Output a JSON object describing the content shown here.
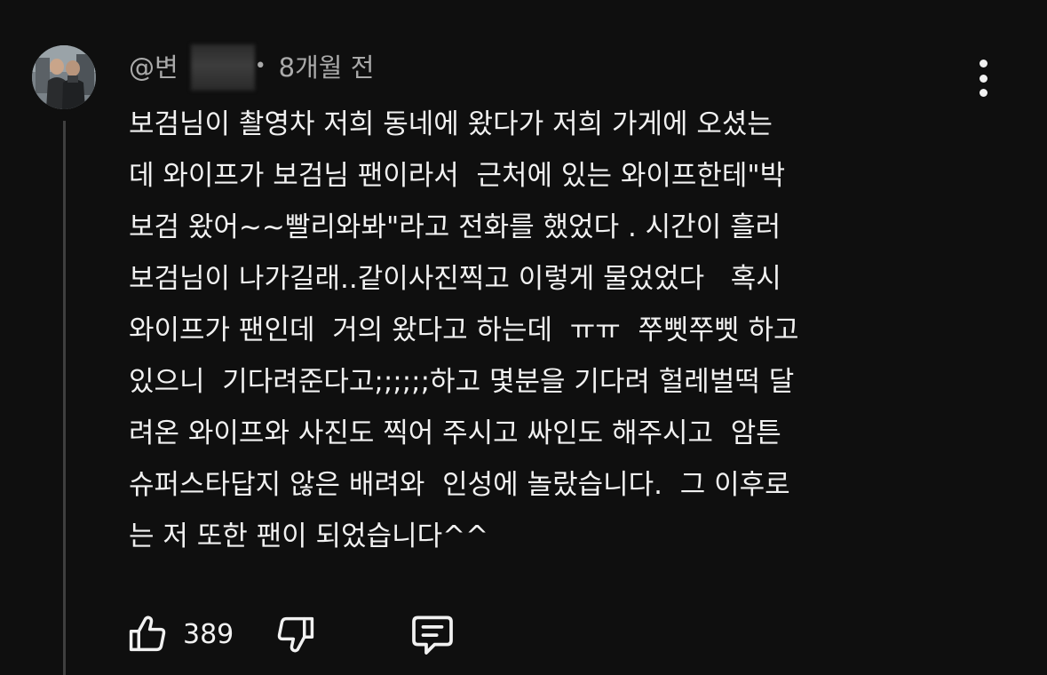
{
  "comment": {
    "author_handle": "@변",
    "timestamp": "8개월 전",
    "separator": "•",
    "lines": [
      "보검님이 촬영차 저희 동네에 왔다가 저희 가게에 오셨는",
      "데 와이프가 보검님 팬이라서  근처에 있는 와이프한테\"박",
      "보검 왔어~~빨리와봐\"라고 전화를 했었다 . 시간이 흘러",
      "보검님이 나가길래..같이사진찍고 이렇게 물었었다   혹시",
      "와이프가 팬인데  거의 왔다고 하는데  ㅠㅠ  쭈삣쭈삣 하고",
      "있으니  기다려준다고;;;;;;하고 몇분을 기다려 헐레벌떡 달",
      "려온 와이프와 사진도 찍어 주시고 싸인도 해주시고  암튼",
      "슈퍼스타답지 않은 배려와  인성에 놀랐습니다.  그 이후로",
      "는 저 또한 팬이 되었습니다^^"
    ],
    "like_count": "389"
  },
  "icons": {
    "avatar": "avatar-photo",
    "more": "more-vertical-icon",
    "like": "thumbs-up-icon",
    "dislike": "thumbs-down-icon",
    "reply": "reply-comment-icon"
  },
  "colors": {
    "background": "#0f0f0f",
    "text": "#f1f1f1",
    "meta_text": "#aaaaaa",
    "thread_line": "#3f3f3f"
  }
}
